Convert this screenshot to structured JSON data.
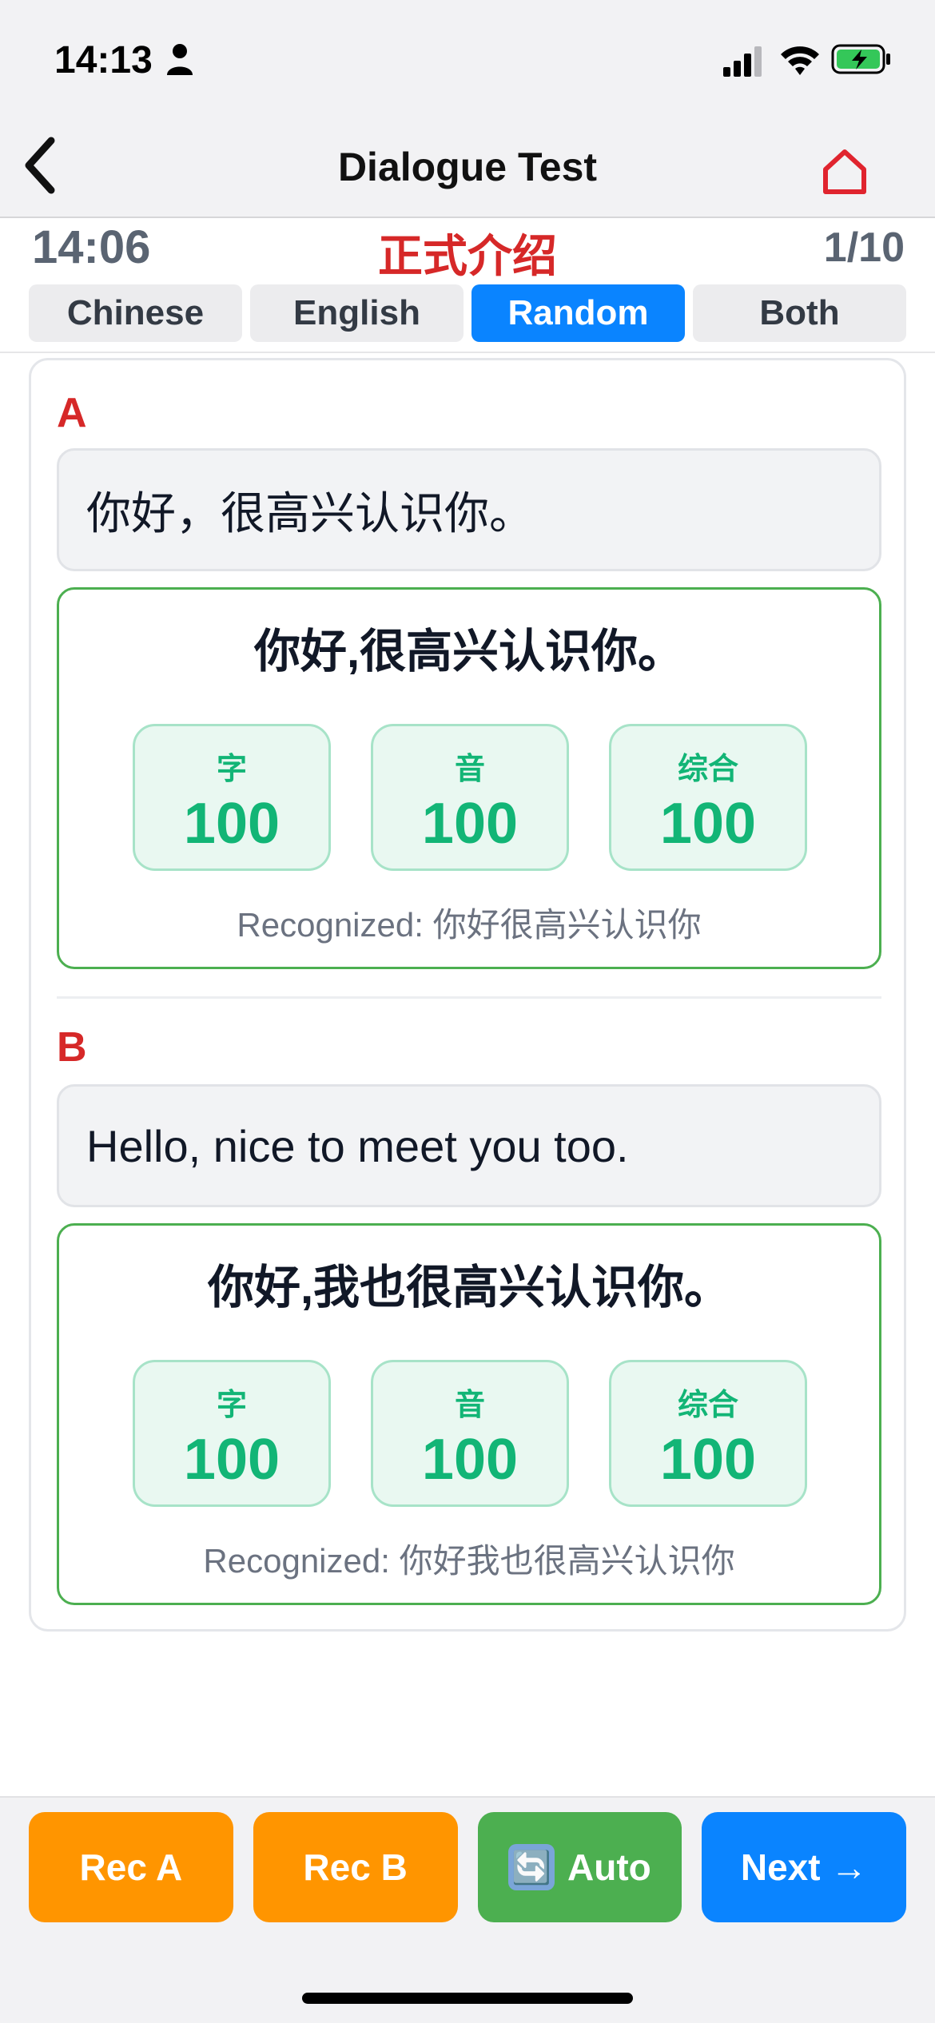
{
  "status_bar": {
    "time": "14:13"
  },
  "nav": {
    "title": "Dialogue Test"
  },
  "info": {
    "timer": "14:06",
    "lesson": "正式介绍",
    "progress": "1/10"
  },
  "tabs": [
    {
      "label": "Chinese",
      "active": false
    },
    {
      "label": "English",
      "active": false
    },
    {
      "label": "Random",
      "active": true
    },
    {
      "label": "Both",
      "active": false
    }
  ],
  "dialogue": [
    {
      "speaker": "A",
      "prompt": "你好，很高兴认识你。",
      "answer": "你好,很高兴认识你。",
      "scores": [
        {
          "label": "字",
          "value": "100"
        },
        {
          "label": "音",
          "value": "100"
        },
        {
          "label": "综合",
          "value": "100"
        }
      ],
      "recognized": "Recognized: 你好很高兴认识你"
    },
    {
      "speaker": "B",
      "prompt": "Hello, nice to meet you too.",
      "answer": "你好,我也很高兴认识你。",
      "scores": [
        {
          "label": "字",
          "value": "100"
        },
        {
          "label": "音",
          "value": "100"
        },
        {
          "label": "综合",
          "value": "100"
        }
      ],
      "recognized": "Recognized: 你好我也很高兴认识你"
    }
  ],
  "buttons": {
    "rec_a": "Rec A",
    "rec_b": "Rec B",
    "auto": "Auto",
    "auto_icon": "🔄",
    "next": "Next →"
  },
  "colors": {
    "accent_blue": "#0a84ff",
    "lesson_red": "#d62828",
    "success_green": "#4caf50",
    "score_green": "#12b576",
    "rec_orange": "#ff9500"
  }
}
